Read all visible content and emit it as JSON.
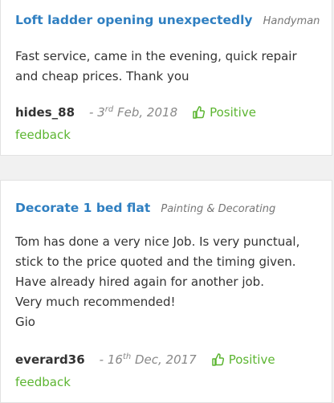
{
  "reviews": [
    {
      "title": "Loft ladder opening unexpectedly",
      "category": "Handyman",
      "body": [
        "Fast service, came in the evening, quick repair",
        "and cheap prices. Thank you"
      ],
      "reviewer": "hides_88",
      "date_prefix": "- 3",
      "date_suffix": "rd",
      "date_rest": " Feb, 2018",
      "feedback_word": "Positive",
      "feedback_word2": "feedback"
    },
    {
      "title": "Decorate 1 bed flat",
      "category": "Painting & Decorating",
      "body": [
        "Tom has done a very nice Job. Is very punctual,",
        "stick to the price quoted and the timing given.",
        "Have already hired again for another job.",
        "Very much recommended!",
        "Gio"
      ],
      "reviewer": "everard36",
      "date_prefix": "- 16",
      "date_suffix": "th",
      "date_rest": " Dec, 2017",
      "feedback_word": "Positive",
      "feedback_word2": "feedback"
    }
  ],
  "colors": {
    "title": "#2f7fc1",
    "positive": "#5cb531",
    "background": "#f1f1f1"
  },
  "icons": {
    "feedback": "thumbs-up-icon"
  }
}
